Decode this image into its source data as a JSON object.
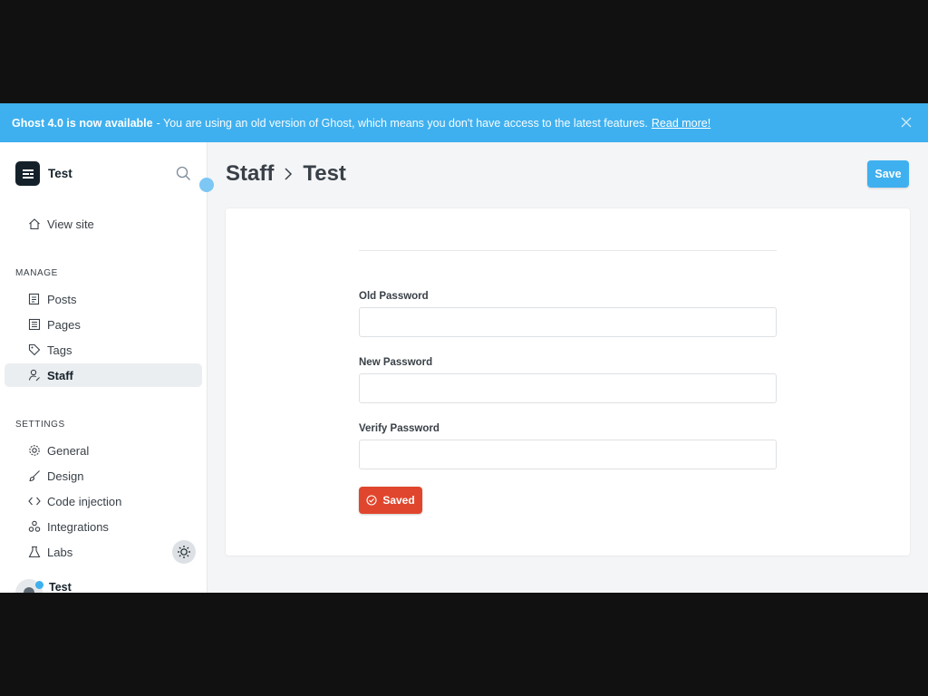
{
  "banner": {
    "title": "Ghost 4.0 is now available",
    "message": "- You are using an old version of Ghost, which means you don't have access to the latest features.",
    "link": "Read more!"
  },
  "sidebar": {
    "site_name": "Test",
    "view_site": "View site",
    "manage_heading": "MANAGE",
    "manage_items": [
      {
        "label": "Posts",
        "icon": "posts-icon"
      },
      {
        "label": "Pages",
        "icon": "pages-icon"
      },
      {
        "label": "Tags",
        "icon": "tag-icon"
      },
      {
        "label": "Staff",
        "icon": "staff-icon",
        "active": true
      }
    ],
    "settings_heading": "SETTINGS",
    "settings_items": [
      {
        "label": "General",
        "icon": "gear-icon"
      },
      {
        "label": "Design",
        "icon": "brush-icon"
      },
      {
        "label": "Code injection",
        "icon": "code-icon"
      },
      {
        "label": "Integrations",
        "icon": "integrations-icon"
      },
      {
        "label": "Labs",
        "icon": "flask-icon"
      }
    ],
    "user_name": "Test"
  },
  "header": {
    "breadcrumb_parent": "Staff",
    "breadcrumb_current": "Test",
    "save_label": "Save"
  },
  "form": {
    "old_password_label": "Old Password",
    "old_password_value": "",
    "new_password_label": "New Password",
    "new_password_value": "",
    "verify_password_label": "Verify Password",
    "verify_password_value": "",
    "saved_label": "Saved"
  },
  "colors": {
    "accent": "#3eb0ef",
    "danger": "#e0462d",
    "dark": "#15212a"
  }
}
